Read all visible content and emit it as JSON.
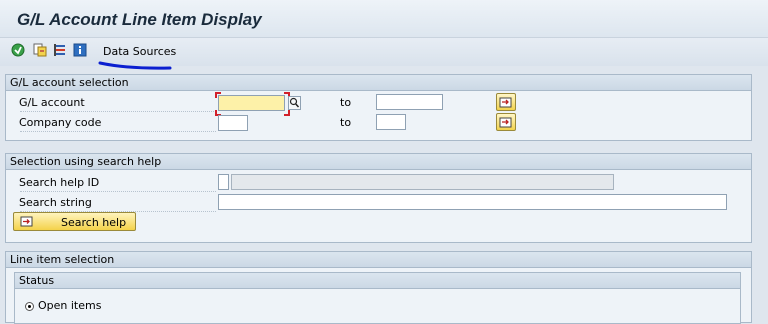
{
  "title": "G/L Account Line Item Display",
  "toolbar": {
    "icons": [
      "execute-icon",
      "get-variant-icon",
      "selection-options-icon",
      "info-icon"
    ],
    "data_sources_label": "Data Sources"
  },
  "gl_selection": {
    "header": "G/L account selection",
    "gl_account_label": "G/L account",
    "company_code_label": "Company code",
    "to_label": "to",
    "gl_account_from": "",
    "gl_account_to": "",
    "company_code_from": "",
    "company_code_to": ""
  },
  "search_help": {
    "header": "Selection using search help",
    "search_help_id_label": "Search help ID",
    "search_string_label": "Search string",
    "search_help_id_value": "",
    "search_string_value": "",
    "button_label": "Search help"
  },
  "line_items": {
    "header": "Line item selection",
    "status_header": "Status",
    "open_items_label": "Open items"
  },
  "colors": {
    "required_field": "#fdf1a8",
    "annotation_underline": "#0b1fd0",
    "group_border": "#a9b9c9"
  }
}
